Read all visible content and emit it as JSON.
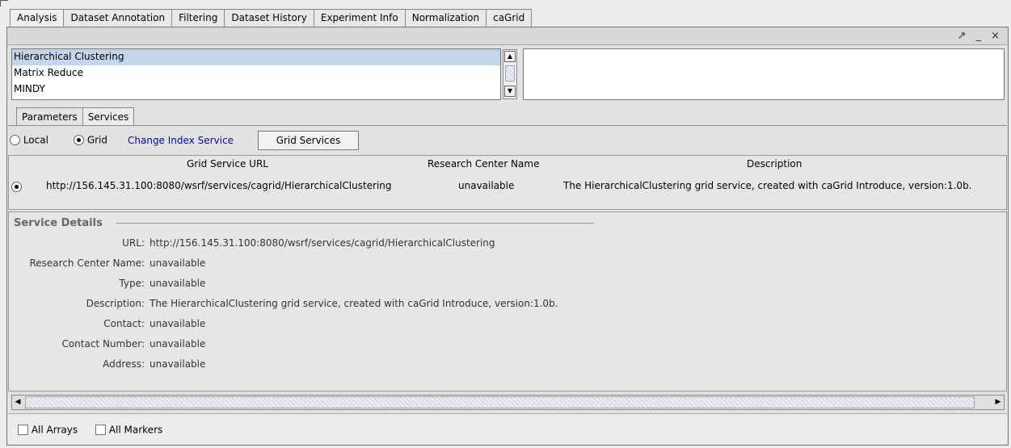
{
  "top_tabs": [
    "Analysis",
    "Dataset Annotation",
    "Filtering",
    "Dataset History",
    "Experiment Info",
    "Normalization",
    "caGrid"
  ],
  "window_controls": "↗ _ ×",
  "analysis_list": [
    "Hierarchical Clustering",
    "Matrix Reduce",
    "MINDY"
  ],
  "sub_tabs": [
    "Parameters",
    "Services"
  ],
  "options": {
    "local_label": "Local",
    "grid_label": "Grid",
    "change_index_link": "Change Index Service",
    "grid_services_button": "Grid Services"
  },
  "services_table": {
    "headers": [
      "Grid Service URL",
      "Research Center Name",
      "Description"
    ],
    "rows": [
      {
        "url": "http://156.145.31.100:8080/wsrf/services/cagrid/HierarchicalClustering",
        "center": "unavailable",
        "description": "The HierarchicalClustering grid service, created with caGrid Introduce, version:1.0b."
      }
    ]
  },
  "service_details": {
    "title": "Service Details",
    "rows": [
      {
        "key": "URL:",
        "value": "http://156.145.31.100:8080/wsrf/services/cagrid/HierarchicalClustering"
      },
      {
        "key": "Research Center Name:",
        "value": "unavailable"
      },
      {
        "key": "Type:",
        "value": "unavailable"
      },
      {
        "key": "Description:",
        "value": "The HierarchicalClustering grid service, created with caGrid Introduce, version:1.0b."
      },
      {
        "key": "Contact:",
        "value": "unavailable"
      },
      {
        "key": "Contact Number:",
        "value": "unavailable"
      },
      {
        "key": "Address:",
        "value": "unavailable"
      }
    ]
  },
  "bottom": {
    "all_arrays": "All Arrays",
    "all_markers": "All Markers"
  },
  "colors": {
    "selection": "#c5d5ea",
    "link": "#0000e0"
  }
}
